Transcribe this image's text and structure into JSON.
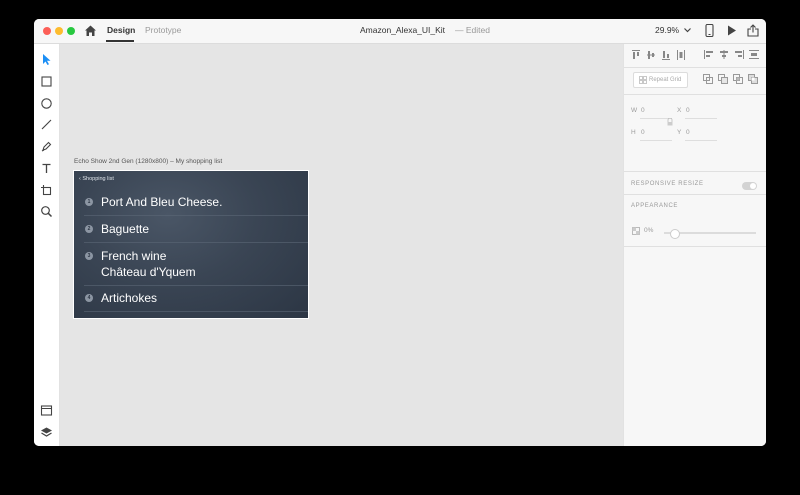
{
  "window": {
    "traffic_lights": {
      "close": "#fc5f57",
      "minimize": "#fdbc2e",
      "zoom": "#28c840"
    }
  },
  "header": {
    "home_icon": "home-icon",
    "tabs": [
      {
        "label": "Design",
        "active": true
      },
      {
        "label": "Prototype",
        "active": false
      }
    ],
    "document_title": "Amazon_Alexa_UI_Kit",
    "document_status": "— Edited",
    "zoom_label": "29.9%",
    "icons": [
      "chevron-down-icon",
      "device-preview-icon",
      "play-icon",
      "share-icon"
    ]
  },
  "toolbar": {
    "tools": [
      "select-icon",
      "rectangle-icon",
      "ellipse-icon",
      "line-icon",
      "pen-icon",
      "text-icon",
      "artboard-icon",
      "zoom-icon"
    ],
    "bottom_tools": [
      "assets-icon",
      "layers-icon"
    ]
  },
  "canvas": {
    "artboard_label": "Echo Show 2nd Gen (1280x800)  – My shopping list",
    "artboard": {
      "back_label": "Shopping list",
      "items": [
        {
          "num": "1",
          "lines": [
            "Port And Bleu Cheese."
          ]
        },
        {
          "num": "2",
          "lines": [
            "Baguette"
          ]
        },
        {
          "num": "3",
          "lines": [
            "French wine",
            "Château d'Yquem"
          ]
        },
        {
          "num": "4",
          "lines": [
            "Artichokes"
          ]
        }
      ]
    }
  },
  "properties": {
    "repeat_grid_label": "Repeat Grid",
    "w_label": "W",
    "w_value": "0",
    "x_label": "X",
    "x_value": "0",
    "h_label": "H",
    "h_value": "0",
    "y_label": "Y",
    "y_value": "0",
    "responsive_resize_label": "RESPONSIVE RESIZE",
    "responsive_resize_on": false,
    "appearance_label": "APPEARANCE",
    "opacity_value": "0%"
  }
}
